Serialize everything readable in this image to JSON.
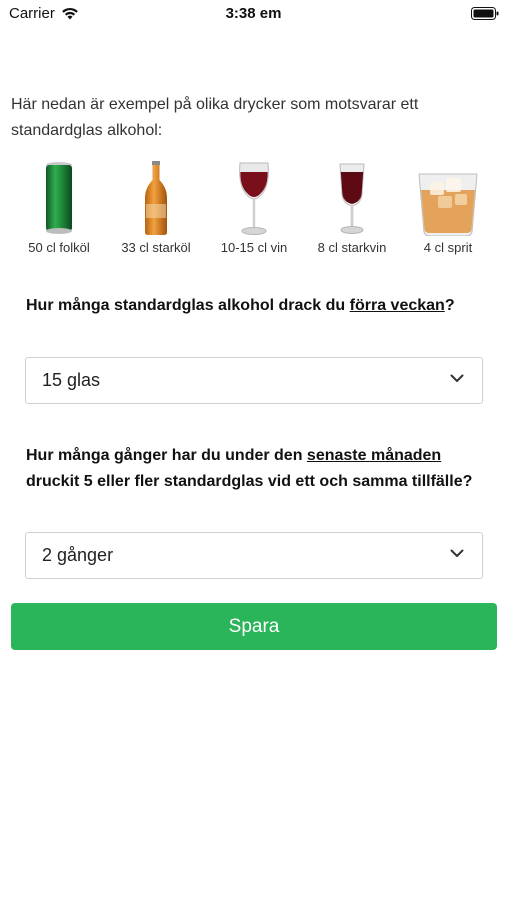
{
  "status_bar": {
    "carrier": "Carrier",
    "time": "3:38 em"
  },
  "intro": "Här nedan är exempel på olika drycker som motsvarar ett standardglas alkohol:",
  "drinks": [
    {
      "label": "50 cl folköl",
      "icon": "beer-can-icon"
    },
    {
      "label": "33 cl starköl",
      "icon": "beer-bottle-icon"
    },
    {
      "label": "10-15 cl vin",
      "icon": "wine-glass-icon"
    },
    {
      "label": "8 cl starkvin",
      "icon": "fortified-wine-glass-icon"
    },
    {
      "label": "4 cl sprit",
      "icon": "spirits-glass-icon"
    }
  ],
  "question1": {
    "text_before": "Hur många standardglas alkohol drack du ",
    "underlined": "förra veckan",
    "text_after": "?",
    "selected": "15 glas"
  },
  "question2": {
    "text_before": "Hur många gånger har du under den ",
    "underlined": "senaste månaden",
    "text_after": " druckit 5 eller fler standardglas vid ett och samma tillfälle?",
    "selected": "2 gånger"
  },
  "save_button": "Spara",
  "colors": {
    "accent": "#2bb55a"
  }
}
